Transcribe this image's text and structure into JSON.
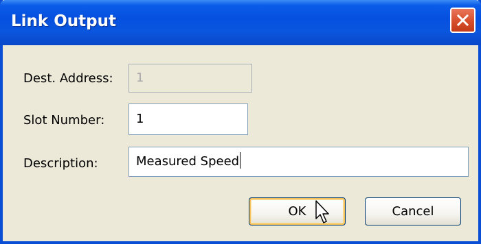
{
  "dialog": {
    "title": "Link Output"
  },
  "fields": {
    "dest_address": {
      "label": "Dest. Address:",
      "value": "1",
      "enabled": false
    },
    "slot_number": {
      "label": "Slot Number:",
      "value": "1"
    },
    "description": {
      "label": "Description:",
      "value": "Measured Speed"
    }
  },
  "buttons": {
    "ok": "OK",
    "cancel": "Cancel"
  },
  "colors": {
    "titlebar": "#0650e0",
    "close_button": "#d9512e",
    "dialog_background": "#ece9d8"
  },
  "icons": {
    "close": "close-icon",
    "cursor": "mouse-pointer-icon"
  }
}
